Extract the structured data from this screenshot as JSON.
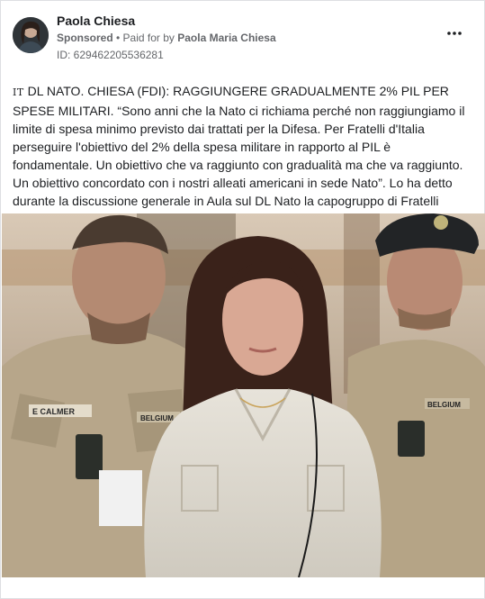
{
  "post": {
    "author_name": "Paola Chiesa",
    "sponsored_label": "Sponsored",
    "paid_prefix": " • Paid for by ",
    "payer": "Paola Maria Chiesa",
    "ad_id": "ID: 629462205536281",
    "more_icon": "more-horizontal-icon",
    "flag_label": "IT",
    "body_text": " DL NATO. CHIESA (FDI): RAGGIUNGERE GRADUALMENTE 2% PIL PER SPESE MILITARI. “Sono anni che la Nato ci richiama perché non raggiungiamo il limite di spesa minimo previsto dai trattati per la Difesa. Per Fratelli d'Italia perseguire l'obiettivo del 2% della spesa militare in rapporto al PIL è fondamentale. Un obiettivo che va raggiunto con gradualità ma che va raggiunto. Un obiettivo concordato con i nostri alleati americani in sede Nato”. Lo ha detto durante la discussione generale in Aula sul DL Nato la capogruppo di Fratelli d'Italia in…"
  },
  "photo": {
    "left_name_tape": "E CALMER",
    "left_patch": "BELGIUM",
    "right_patch": "BELGIUM"
  },
  "colors": {
    "text_primary": "#1c1e21",
    "text_secondary": "#65676b",
    "border": "#dddfe2"
  }
}
